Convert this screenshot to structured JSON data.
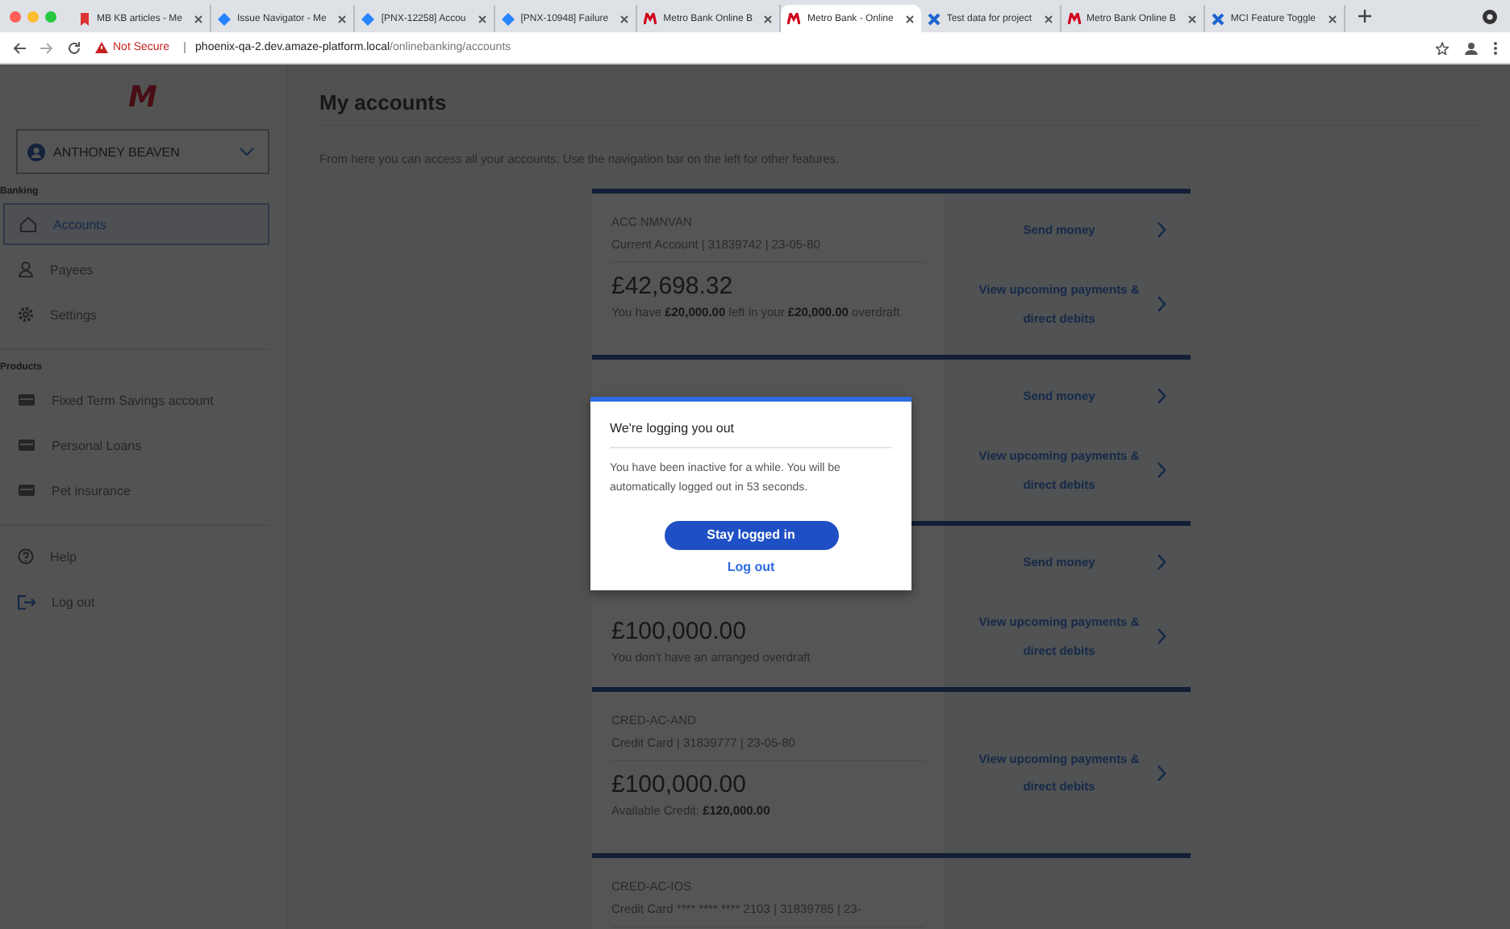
{
  "browser": {
    "tabs": [
      {
        "title": "MB KB articles - Me",
        "kind": "pin",
        "selected": false
      },
      {
        "title": "Issue Navigator - Me",
        "kind": "diamond",
        "selected": false
      },
      {
        "title": "[PNX-12258] Accou",
        "kind": "diamond",
        "selected": false
      },
      {
        "title": "[PNX-10948] Failure",
        "kind": "diamond",
        "selected": false
      },
      {
        "title": "Metro Bank Online B",
        "kind": "logo",
        "selected": false
      },
      {
        "title": "Metro Bank - Online",
        "kind": "logo",
        "selected": true
      },
      {
        "title": "Test data for project",
        "kind": "tools",
        "selected": false
      },
      {
        "title": "Metro Bank Online B",
        "kind": "logo",
        "selected": false
      },
      {
        "title": "MCI Feature Toggle",
        "kind": "tools",
        "selected": false
      }
    ],
    "security": "Not Secure",
    "url_host": "phoenix-qa-2.dev.amaze-platform.local",
    "url_path": "/onlinebanking/accounts"
  },
  "sidebar": {
    "logo": "M",
    "user": "ANTHONEY BEAVEN",
    "sections": [
      {
        "heading": "Banking",
        "items": [
          {
            "label": "Accounts",
            "kind": "home",
            "selected": true
          },
          {
            "label": "Payees",
            "kind": "person",
            "selected": false
          },
          {
            "label": "Settings",
            "kind": "gear",
            "selected": false
          }
        ]
      },
      {
        "heading": "Products",
        "items": [
          {
            "label": "Fixed Term Savings account",
            "kind": "card",
            "selected": false
          },
          {
            "label": "Personal Loans",
            "kind": "card",
            "selected": false
          },
          {
            "label": "Pet insurance",
            "kind": "card",
            "selected": false
          }
        ]
      },
      {
        "items": [
          {
            "label": "Help",
            "kind": "help",
            "selected": false
          },
          {
            "label": "Log out",
            "kind": "logout",
            "selected": false
          }
        ]
      }
    ]
  },
  "page": {
    "title": "My accounts",
    "description": "From here you can access all your accounts. Use the navigation bar on the left for other features.",
    "accounts": [
      {
        "name": "ACC NMNVAN",
        "details": "Current Account  |  31839742  |  23-05-80",
        "balance": "£42,698.32",
        "note": "You have **£20,000.00** left in your **£20,000.00** overdraft",
        "actions": [
          "Send money",
          "View upcoming payments & direct debits"
        ]
      },
      {
        "actions": [
          "Send money",
          "View upcoming payments & direct debits"
        ]
      },
      {
        "balance": "£100,000.00",
        "note": "You don't have an arranged overdraft",
        "actions": [
          "Send money",
          "View upcoming payments & direct debits"
        ]
      },
      {
        "name": "CRED-AC-AND",
        "details": "Credit Card  |  31839777  |  23-05-80",
        "balance": "£100,000.00",
        "note": "Available Credit: **£120,000.00**",
        "actions": [
          "View upcoming payments & direct debits"
        ]
      },
      {
        "name": "CRED-AC-IOS",
        "details": "Credit Card **** **** **** 2103  |  31839785  |  23-"
      }
    ]
  },
  "dialog": {
    "title": "We're logging you out",
    "message": "You have been inactive for a while. You will be automatically logged out in 53 seconds.",
    "primary": "Stay logged in",
    "secondary": "Log out"
  }
}
